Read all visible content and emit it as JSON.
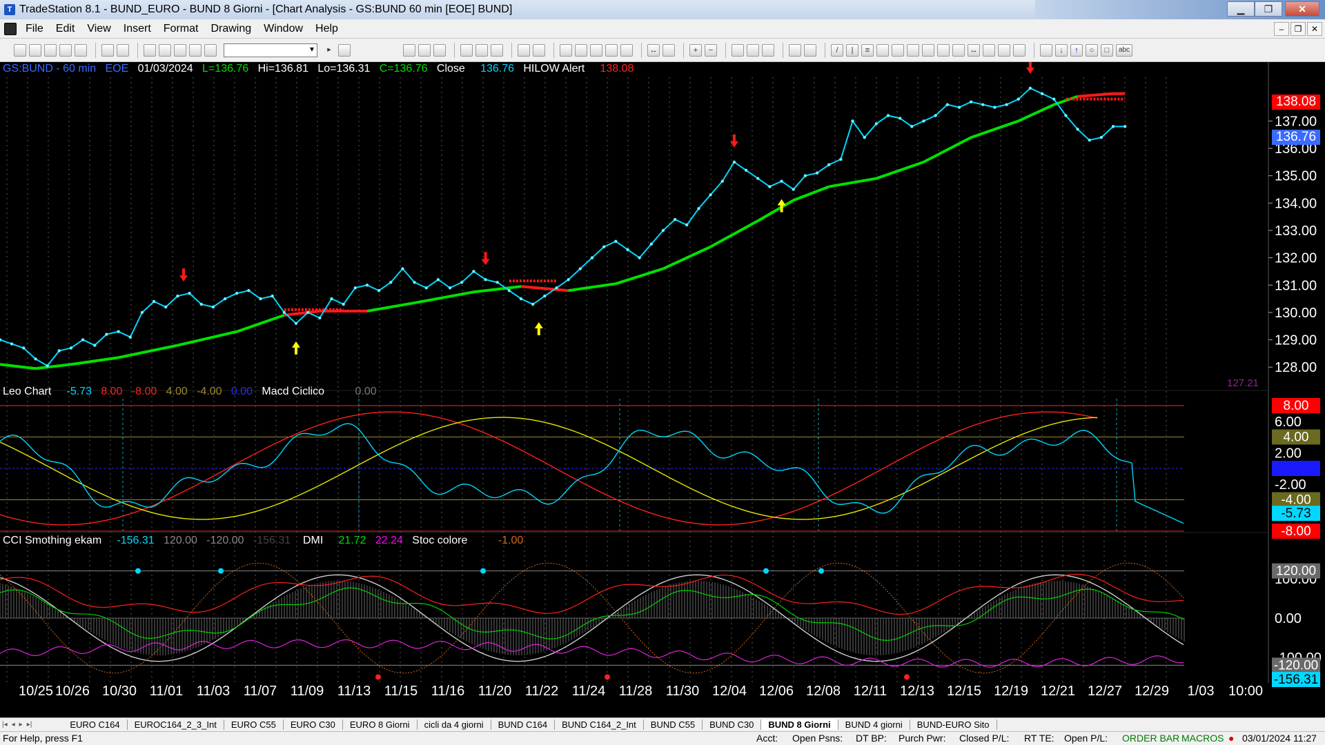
{
  "window": {
    "title": "TradeStation 8.1 - BUND_EURO - BUND 8 Giorni - [Chart Analysis - GS:BUND  60 min  [EOE] BUND]"
  },
  "menu": [
    "File",
    "Edit",
    "View",
    "Insert",
    "Format",
    "Drawing",
    "Window",
    "Help"
  ],
  "colors": {
    "price": "#00d8ff",
    "ma_up": "#00e000",
    "ma_down": "#ff1a1a",
    "arrow_up": "#ffff00",
    "arrow_down": "#ff1a1a",
    "grid": "#00b8c8"
  },
  "header": {
    "symbol": "GS:BUND - 60 min",
    "exch": "EOE",
    "date": "01/03/2024",
    "last": "L=136.76",
    "hi": "Hi=136.81",
    "lo": "Lo=136.31",
    "close_val": "C=136.76",
    "close_label": "Close",
    "close_num": "136.76",
    "hilow_label": "HILOW Alert",
    "hilow_num": "138.08"
  },
  "panel2": {
    "name": "Leo Chart",
    "v1": "-5.73",
    "v2": "8.00",
    "v3": "-8.00",
    "v4": "4.00",
    "v5": "-4.00",
    "v6": "0.00",
    "name2": "Macd Ciclico",
    "v7": "0.00"
  },
  "panel3": {
    "name": "CCI Smothing ekam",
    "v1": "-156.31",
    "v2": "120.00",
    "v3": "-120.00",
    "v4": "-156.31",
    "name2": "DMI",
    "v5": "21.72",
    "v6": "22.24",
    "name3": "Stoc colore",
    "v7": "-1.00"
  },
  "price_axis": {
    "ticks": [
      "137.00",
      "136.00",
      "135.00",
      "134.00",
      "133.00",
      "132.00",
      "131.00",
      "130.00",
      "129.00",
      "128.00"
    ],
    "hilow_box": "138.08",
    "last_box": "136.76",
    "extra": "127.21"
  },
  "panel2_axis": {
    "ticks": [
      "6.00",
      "2.00",
      "-2.00"
    ],
    "boxes": [
      "8.00",
      "4.00",
      "0.00",
      "-4.00",
      "-5.73",
      "-8.00"
    ]
  },
  "panel3_axis": {
    "ticks": [
      "100.00",
      "0.00",
      "-100.00"
    ],
    "boxes": [
      "120.00",
      "-120.00",
      "-156.31"
    ]
  },
  "dates": [
    "10/25",
    "10/26",
    "10/30",
    "11/01",
    "11/03",
    "11/07",
    "11/09",
    "11/13",
    "11/15",
    "11/16",
    "11/20",
    "11/22",
    "11/24",
    "11/28",
    "11/30",
    "12/04",
    "12/06",
    "12/08",
    "12/11",
    "12/13",
    "12/15",
    "12/19",
    "12/21",
    "12/27",
    "12/29",
    "1/03",
    "10:00"
  ],
  "tabs": [
    "EURO C164",
    "EUROC164_2_3_Int",
    "EURO C55",
    "EURO C30",
    "EURO 8 Giorni",
    "cicli da 4 giorni",
    "BUND C164",
    "BUND C164_2_Int",
    "BUND C55",
    "BUND  C30",
    "BUND 8 Giorni",
    "BUND 4 giorni",
    "BUND-EURO Sito"
  ],
  "active_tab": "BUND 8 Giorni",
  "status": {
    "help": "For Help, press F1",
    "acct": "Acct:",
    "open_psns": "Open Psns:",
    "dt_bp": "DT BP:",
    "purch_pwr": "Purch Pwr:",
    "closed_pl": "Closed P/L:",
    "rt_te": "RT TE:",
    "open_pl": "Open P/L:",
    "order_bar": "ORDER BAR",
    "macros": "MACROS",
    "datetime": "03/01/2024 11:27"
  },
  "chart_data": {
    "type": "line",
    "ylim": [
      127.3,
      138.6
    ],
    "price_series": [
      [
        0,
        129.0
      ],
      [
        0.01,
        128.85
      ],
      [
        0.02,
        128.7
      ],
      [
        0.03,
        128.3
      ],
      [
        0.04,
        128.05
      ],
      [
        0.05,
        128.6
      ],
      [
        0.06,
        128.7
      ],
      [
        0.07,
        129.0
      ],
      [
        0.08,
        128.8
      ],
      [
        0.09,
        129.2
      ],
      [
        0.1,
        129.3
      ],
      [
        0.11,
        129.1
      ],
      [
        0.12,
        130.0
      ],
      [
        0.13,
        130.4
      ],
      [
        0.14,
        130.2
      ],
      [
        0.15,
        130.6
      ],
      [
        0.16,
        130.7
      ],
      [
        0.17,
        130.3
      ],
      [
        0.18,
        130.2
      ],
      [
        0.19,
        130.5
      ],
      [
        0.2,
        130.7
      ],
      [
        0.21,
        130.8
      ],
      [
        0.22,
        130.5
      ],
      [
        0.23,
        130.6
      ],
      [
        0.24,
        130.0
      ],
      [
        0.25,
        129.6
      ],
      [
        0.26,
        130.0
      ],
      [
        0.27,
        129.8
      ],
      [
        0.28,
        130.5
      ],
      [
        0.29,
        130.3
      ],
      [
        0.3,
        130.9
      ],
      [
        0.31,
        131.0
      ],
      [
        0.32,
        130.8
      ],
      [
        0.33,
        131.1
      ],
      [
        0.34,
        131.6
      ],
      [
        0.35,
        131.1
      ],
      [
        0.36,
        130.9
      ],
      [
        0.37,
        131.2
      ],
      [
        0.38,
        130.9
      ],
      [
        0.39,
        131.1
      ],
      [
        0.4,
        131.5
      ],
      [
        0.41,
        131.2
      ],
      [
        0.42,
        131.1
      ],
      [
        0.43,
        130.8
      ],
      [
        0.44,
        130.5
      ],
      [
        0.45,
        130.3
      ],
      [
        0.46,
        130.6
      ],
      [
        0.47,
        130.9
      ],
      [
        0.48,
        131.2
      ],
      [
        0.49,
        131.6
      ],
      [
        0.5,
        132.0
      ],
      [
        0.51,
        132.4
      ],
      [
        0.52,
        132.6
      ],
      [
        0.53,
        132.3
      ],
      [
        0.54,
        132.0
      ],
      [
        0.55,
        132.5
      ],
      [
        0.56,
        133.0
      ],
      [
        0.57,
        133.4
      ],
      [
        0.58,
        133.2
      ],
      [
        0.59,
        133.8
      ],
      [
        0.6,
        134.3
      ],
      [
        0.61,
        134.8
      ],
      [
        0.62,
        135.5
      ],
      [
        0.63,
        135.2
      ],
      [
        0.64,
        134.9
      ],
      [
        0.65,
        134.6
      ],
      [
        0.66,
        134.8
      ],
      [
        0.67,
        134.5
      ],
      [
        0.68,
        135.0
      ],
      [
        0.69,
        135.1
      ],
      [
        0.7,
        135.4
      ],
      [
        0.71,
        135.6
      ],
      [
        0.72,
        137.0
      ],
      [
        0.73,
        136.4
      ],
      [
        0.74,
        136.9
      ],
      [
        0.75,
        137.2
      ],
      [
        0.76,
        137.1
      ],
      [
        0.77,
        136.8
      ],
      [
        0.78,
        137.0
      ],
      [
        0.79,
        137.2
      ],
      [
        0.8,
        137.6
      ],
      [
        0.81,
        137.5
      ],
      [
        0.82,
        137.7
      ],
      [
        0.83,
        137.6
      ],
      [
        0.84,
        137.5
      ],
      [
        0.85,
        137.6
      ],
      [
        0.86,
        137.8
      ],
      [
        0.87,
        138.2
      ],
      [
        0.88,
        138.0
      ],
      [
        0.89,
        137.8
      ],
      [
        0.9,
        137.2
      ],
      [
        0.91,
        136.7
      ],
      [
        0.92,
        136.3
      ],
      [
        0.93,
        136.4
      ],
      [
        0.94,
        136.8
      ],
      [
        0.95,
        136.8
      ]
    ],
    "ma_series": [
      [
        0,
        128.1
      ],
      [
        0.03,
        127.95
      ],
      [
        0.06,
        128.1
      ],
      [
        0.1,
        128.35
      ],
      [
        0.15,
        128.8
      ],
      [
        0.2,
        129.3
      ],
      [
        0.24,
        129.9
      ],
      [
        0.27,
        130.05
      ],
      [
        0.31,
        130.05
      ],
      [
        0.35,
        130.35
      ],
      [
        0.4,
        130.75
      ],
      [
        0.44,
        130.95
      ],
      [
        0.48,
        130.8
      ],
      [
        0.52,
        131.05
      ],
      [
        0.56,
        131.6
      ],
      [
        0.6,
        132.4
      ],
      [
        0.64,
        133.35
      ],
      [
        0.67,
        134.1
      ],
      [
        0.7,
        134.6
      ],
      [
        0.74,
        134.9
      ],
      [
        0.78,
        135.5
      ],
      [
        0.82,
        136.4
      ],
      [
        0.86,
        137.0
      ],
      [
        0.89,
        137.6
      ],
      [
        0.91,
        137.9
      ],
      [
        0.94,
        138.0
      ],
      [
        0.95,
        138.0
      ]
    ],
    "ma_red_segments": [
      [
        0.24,
        0.29
      ],
      [
        0.43,
        0.47
      ],
      [
        0.9,
        0.95
      ]
    ],
    "up_arrows": [
      0.25,
      0.455,
      0.66
    ],
    "down_arrows": [
      0.155,
      0.41,
      0.62,
      0.87
    ]
  }
}
